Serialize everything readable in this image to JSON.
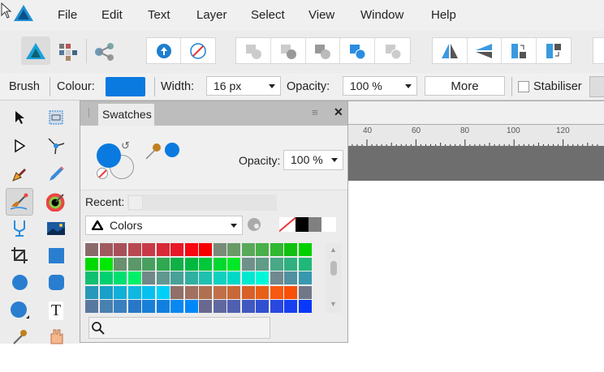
{
  "menubar": {
    "items": [
      "File",
      "Edit",
      "Text",
      "Layer",
      "Select",
      "View",
      "Window",
      "Help"
    ]
  },
  "context": {
    "tool": "Brush",
    "colour_label": "Colour:",
    "colour": "#0a7ae0",
    "width_label": "Width:",
    "width_value": "16 px",
    "opacity_label": "Opacity:",
    "opacity_value": "100 %",
    "more_label": "More",
    "stabiliser_label": "Stabiliser",
    "stabiliser_checked": false
  },
  "swatches": {
    "tab": "Swatches",
    "opacity_label": "Opacity:",
    "opacity_value": "100 %",
    "recent_label": "Recent:",
    "palette": "Colors",
    "fill_color": "#0a7ae0",
    "picked_color": "#0a7ae0",
    "grid": [
      [
        "#8b6a6a",
        "#a05a5e",
        "#a8505a",
        "#b84850",
        "#c83a48",
        "#d82838",
        "#e81828",
        "#f80810",
        "#f80000",
        "#7a8a78",
        "#6a9a68",
        "#5aa85a",
        "#48b048",
        "#30b830",
        "#10c010",
        "#00d000"
      ],
      [
        "#00d800",
        "#00e800",
        "#6a9070",
        "#5a9868",
        "#48a060",
        "#30a850",
        "#10b048",
        "#00b840",
        "#00c838",
        "#00d830",
        "#00e828",
        "#70908a",
        "#609c88",
        "#48a888",
        "#30b080",
        "#20b878"
      ],
      [
        "#10c070",
        "#00d070",
        "#00e070",
        "#00f068",
        "#708888",
        "#609890",
        "#48a098",
        "#30b0a0",
        "#20c0b0",
        "#10d0c0",
        "#00d8c8",
        "#00e8d0",
        "#00f8d8",
        "#708890",
        "#5090a0",
        "#3898b0"
      ],
      [
        "#2898b8",
        "#18a0c8",
        "#10b0d8",
        "#10b8e0",
        "#08c0f0",
        "#00d0f8",
        "#907068",
        "#a07060",
        "#b07050",
        "#c07048",
        "#c86838",
        "#d86028",
        "#e86018",
        "#f85810",
        "#f85008",
        "#707888"
      ],
      [
        "#5878a0",
        "#4880b0",
        "#3880c0",
        "#2878c8",
        "#1880d8",
        "#1080e0",
        "#0888f0",
        "#0088f8",
        "#686890",
        "#6068a0",
        "#5060b0",
        "#4058c0",
        "#3050d0",
        "#2848e0",
        "#1840f0",
        "#0838f8"
      ]
    ]
  },
  "ruler": {
    "labels": [
      "40",
      "60",
      "80",
      "100",
      "120"
    ]
  }
}
